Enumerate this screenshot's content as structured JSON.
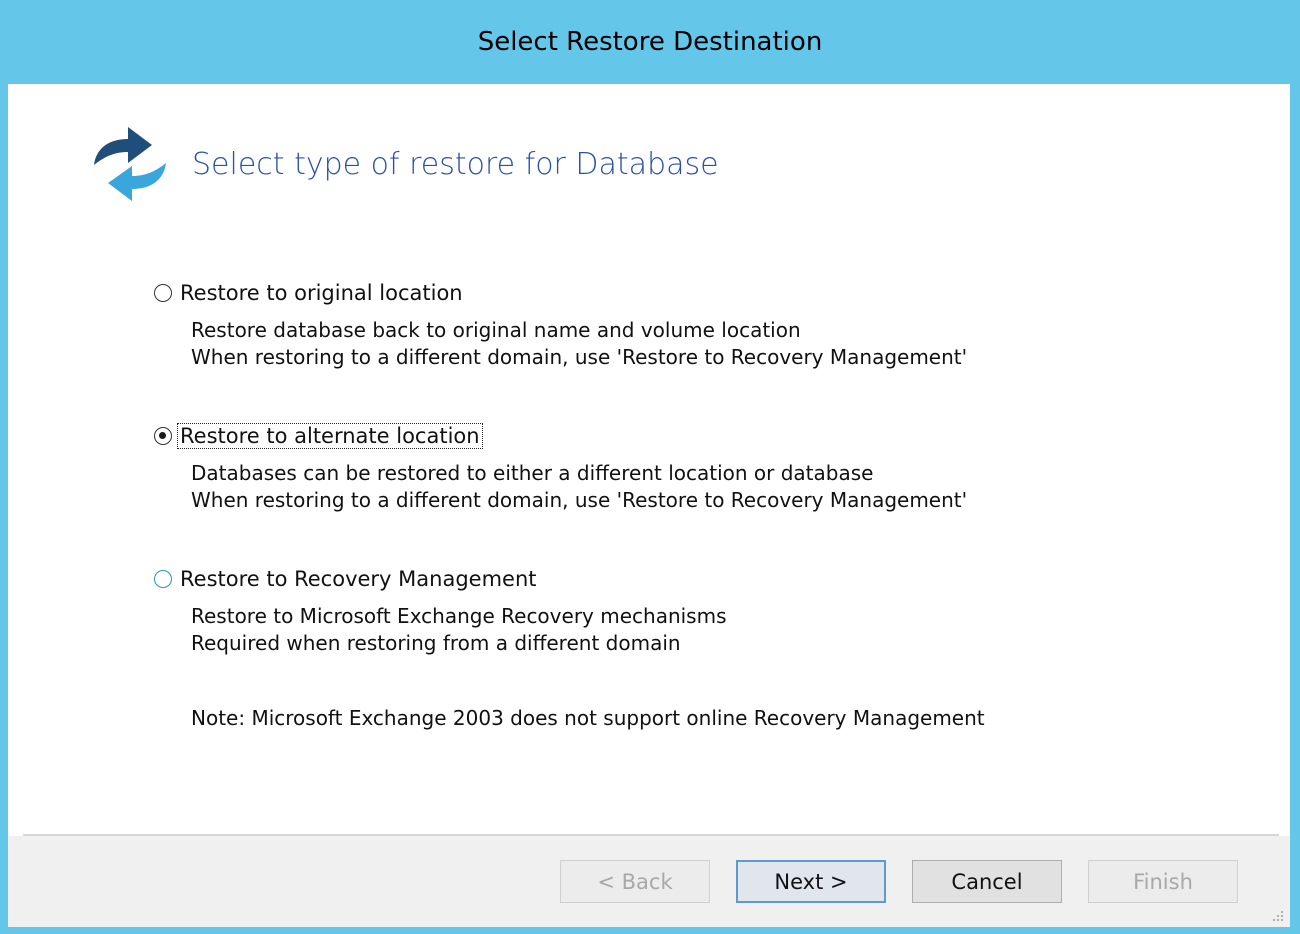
{
  "window": {
    "title": "Select Restore Destination"
  },
  "header": {
    "title": "Select type of restore for Database",
    "icon": "refresh-arrows-icon"
  },
  "options": [
    {
      "label": "Restore to original location",
      "selected": false,
      "desc_line1": "Restore database back to original name and volume location",
      "desc_line2": "When restoring to a different domain, use 'Restore to Recovery Management'"
    },
    {
      "label": "Restore to alternate location",
      "selected": true,
      "desc_line1": "Databases can be restored to either a different location or database",
      "desc_line2": "When restoring to a different domain, use 'Restore to Recovery Management'"
    },
    {
      "label": "Restore to Recovery Management",
      "selected": false,
      "desc_line1": "Restore to Microsoft Exchange Recovery mechanisms",
      "desc_line2": "Required when restoring from a different domain"
    }
  ],
  "note": "Note: Microsoft Exchange 2003 does not support online Recovery Management",
  "buttons": {
    "back": "< Back",
    "next": "Next >",
    "cancel": "Cancel",
    "finish": "Finish"
  },
  "colors": {
    "titlebar": "#64c7ea",
    "header_text": "#2b4fa8",
    "icon_dark": "#1e4e79",
    "icon_light": "#3aa6dc"
  }
}
